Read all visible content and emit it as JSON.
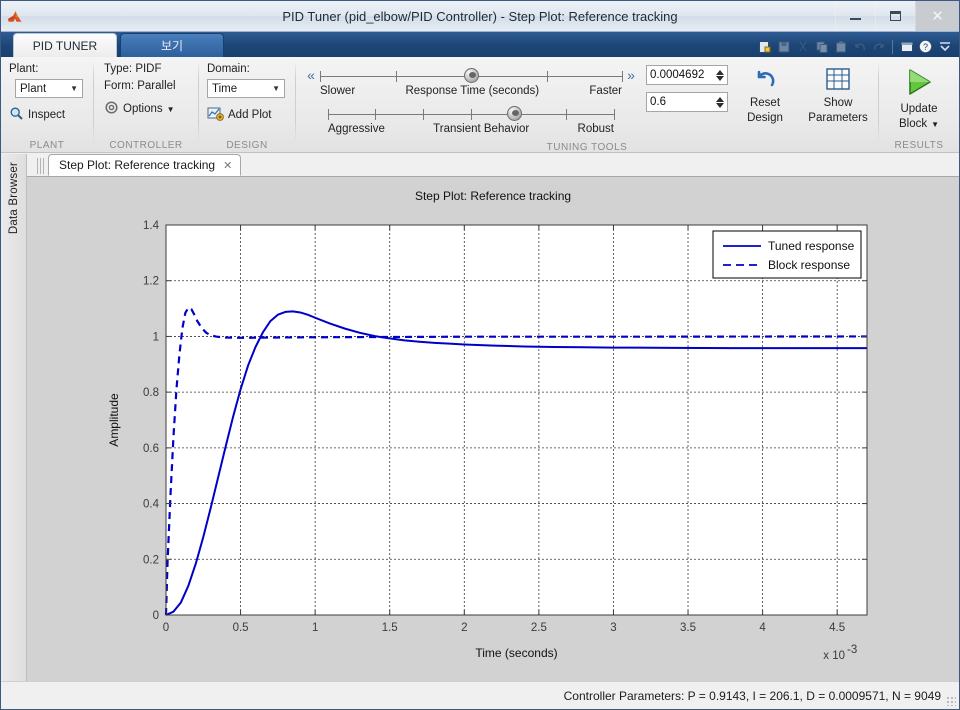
{
  "window": {
    "title": "PID Tuner (pid_elbow/PID Controller) - Step Plot: Reference tracking",
    "logo_icon": "matlab-logo-icon",
    "minimize_label": "Minimize",
    "maximize_label": "Maximize",
    "close_label": "Close"
  },
  "ribbon": {
    "tabs": [
      {
        "label": "PID TUNER",
        "active": true
      },
      {
        "label": "보기",
        "active": false
      }
    ],
    "quick_access": [
      "new-icon",
      "save-icon",
      "cut-icon",
      "copy-icon",
      "paste-icon",
      "undo-icon",
      "redo-icon",
      "layout-icon",
      "help-icon"
    ],
    "collapse_icon": "collapse-ribbon-icon",
    "groups": {
      "plant": {
        "section_label": "PLANT",
        "caption": "Plant:",
        "combo_value": "Plant",
        "inspect_label": "Inspect",
        "inspect_icon": "magnifier-icon"
      },
      "controller": {
        "section_label": "CONTROLLER",
        "type_label": "Type: PIDF",
        "form_label": "Form: Parallel",
        "options_label": "Options",
        "options_icon": "gear-icon"
      },
      "design": {
        "section_label": "DESIGN",
        "caption": "Domain:",
        "combo_value": "Time",
        "add_plot_label": "Add Plot",
        "add_plot_icon": "add-plot-icon"
      },
      "tuning": {
        "section_label": "TUNING TOOLS",
        "prev_icon": "chevron-double-left-icon",
        "next_icon": "chevron-double-right-icon",
        "response_time": {
          "left_label": "Slower",
          "center_label": "Response Time (seconds)",
          "right_label": "Faster",
          "knob_percent": 50,
          "value": "0.0004692"
        },
        "transient_behavior": {
          "left_label": "Aggressive",
          "center_label": "Transient Behavior",
          "right_label": "Robust",
          "knob_percent": 65,
          "value": "0.6"
        }
      },
      "results": {
        "section_label": "RESULTS",
        "reset_design_label_1": "Reset",
        "reset_design_label_2": "Design",
        "reset_icon": "undo-arrow-icon",
        "show_parameters_label_1": "Show",
        "show_parameters_label_2": "Parameters",
        "show_parameters_icon": "table-icon",
        "update_block_label_1": "Update",
        "update_block_label_2": "Block",
        "update_block_icon": "green-play-icon",
        "update_block_caret": "chevron-down-icon"
      }
    }
  },
  "sidebar": {
    "data_browser_label": "Data Browser"
  },
  "document": {
    "tab_label": "Step Plot: Reference tracking",
    "tab_close_icon": "close-icon"
  },
  "statusbar": {
    "text": "Controller Parameters: P = 0.9143, I = 206.1, D = 0.0009571, N = 9049"
  },
  "colors": {
    "curve": "#0000c8",
    "plot_background": "#ffffff",
    "panel_background": "#d2d2d2",
    "accent": "#1d4576"
  },
  "chart_data": {
    "type": "line",
    "title": "Step Plot: Reference tracking",
    "xlabel": "Time (seconds)",
    "ylabel": "Amplitude",
    "x_multiplier": "x 10",
    "x_multiplier_exp": "-3",
    "xlim": [
      0,
      4.7
    ],
    "ylim": [
      0,
      1.4
    ],
    "xticks": [
      0,
      0.5,
      1,
      1.5,
      2,
      2.5,
      3,
      3.5,
      4,
      4.5
    ],
    "xticklabels": [
      "0",
      "0.5",
      "1",
      "1.5",
      "2",
      "2.5",
      "3",
      "3.5",
      "4",
      "4.5"
    ],
    "yticks": [
      0,
      0.2,
      0.4,
      0.6,
      0.8,
      1,
      1.2,
      1.4
    ],
    "yticklabels": [
      "0",
      "0.2",
      "0.4",
      "0.6",
      "0.8",
      "1",
      "1.2",
      "1.4"
    ],
    "grid": true,
    "legend_position": "top-right",
    "series": [
      {
        "name": "Tuned response",
        "style": "solid",
        "color": "#0000c8",
        "points": [
          [
            0.0,
            0.0
          ],
          [
            0.05,
            0.012
          ],
          [
            0.1,
            0.045
          ],
          [
            0.15,
            0.105
          ],
          [
            0.2,
            0.185
          ],
          [
            0.25,
            0.28
          ],
          [
            0.3,
            0.385
          ],
          [
            0.35,
            0.495
          ],
          [
            0.4,
            0.605
          ],
          [
            0.45,
            0.712
          ],
          [
            0.5,
            0.81
          ],
          [
            0.55,
            0.895
          ],
          [
            0.6,
            0.962
          ],
          [
            0.65,
            1.015
          ],
          [
            0.7,
            1.055
          ],
          [
            0.75,
            1.078
          ],
          [
            0.8,
            1.088
          ],
          [
            0.85,
            1.09
          ],
          [
            0.9,
            1.086
          ],
          [
            0.95,
            1.078
          ],
          [
            1.0,
            1.067
          ],
          [
            1.1,
            1.046
          ],
          [
            1.2,
            1.028
          ],
          [
            1.3,
            1.013
          ],
          [
            1.4,
            1.001
          ],
          [
            1.5,
            0.993
          ],
          [
            1.6,
            0.986
          ],
          [
            1.7,
            0.981
          ],
          [
            1.8,
            0.977
          ],
          [
            1.9,
            0.974
          ],
          [
            2.0,
            0.971
          ],
          [
            2.2,
            0.967
          ],
          [
            2.4,
            0.964
          ],
          [
            2.6,
            0.962
          ],
          [
            2.8,
            0.961
          ],
          [
            3.0,
            0.96
          ],
          [
            3.4,
            0.959
          ],
          [
            3.8,
            0.958
          ],
          [
            4.2,
            0.958
          ],
          [
            4.7,
            0.958
          ]
        ]
      },
      {
        "name": "Block response",
        "style": "dashed",
        "color": "#0000c8",
        "points": [
          [
            0.0,
            0.0
          ],
          [
            0.01,
            0.185
          ],
          [
            0.03,
            0.43
          ],
          [
            0.05,
            0.64
          ],
          [
            0.07,
            0.81
          ],
          [
            0.09,
            0.935
          ],
          [
            0.11,
            1.03
          ],
          [
            0.13,
            1.085
          ],
          [
            0.15,
            1.103
          ],
          [
            0.17,
            1.098
          ],
          [
            0.19,
            1.078
          ],
          [
            0.21,
            1.055
          ],
          [
            0.24,
            1.03
          ],
          [
            0.27,
            1.013
          ],
          [
            0.3,
            1.004
          ],
          [
            0.34,
            0.999
          ],
          [
            0.4,
            0.996
          ],
          [
            0.5,
            0.995
          ],
          [
            0.7,
            0.996
          ],
          [
            1.0,
            0.997
          ],
          [
            1.5,
            0.998
          ],
          [
            2.0,
            0.999
          ],
          [
            3.0,
            0.999
          ],
          [
            4.7,
            1.0
          ]
        ]
      }
    ]
  }
}
